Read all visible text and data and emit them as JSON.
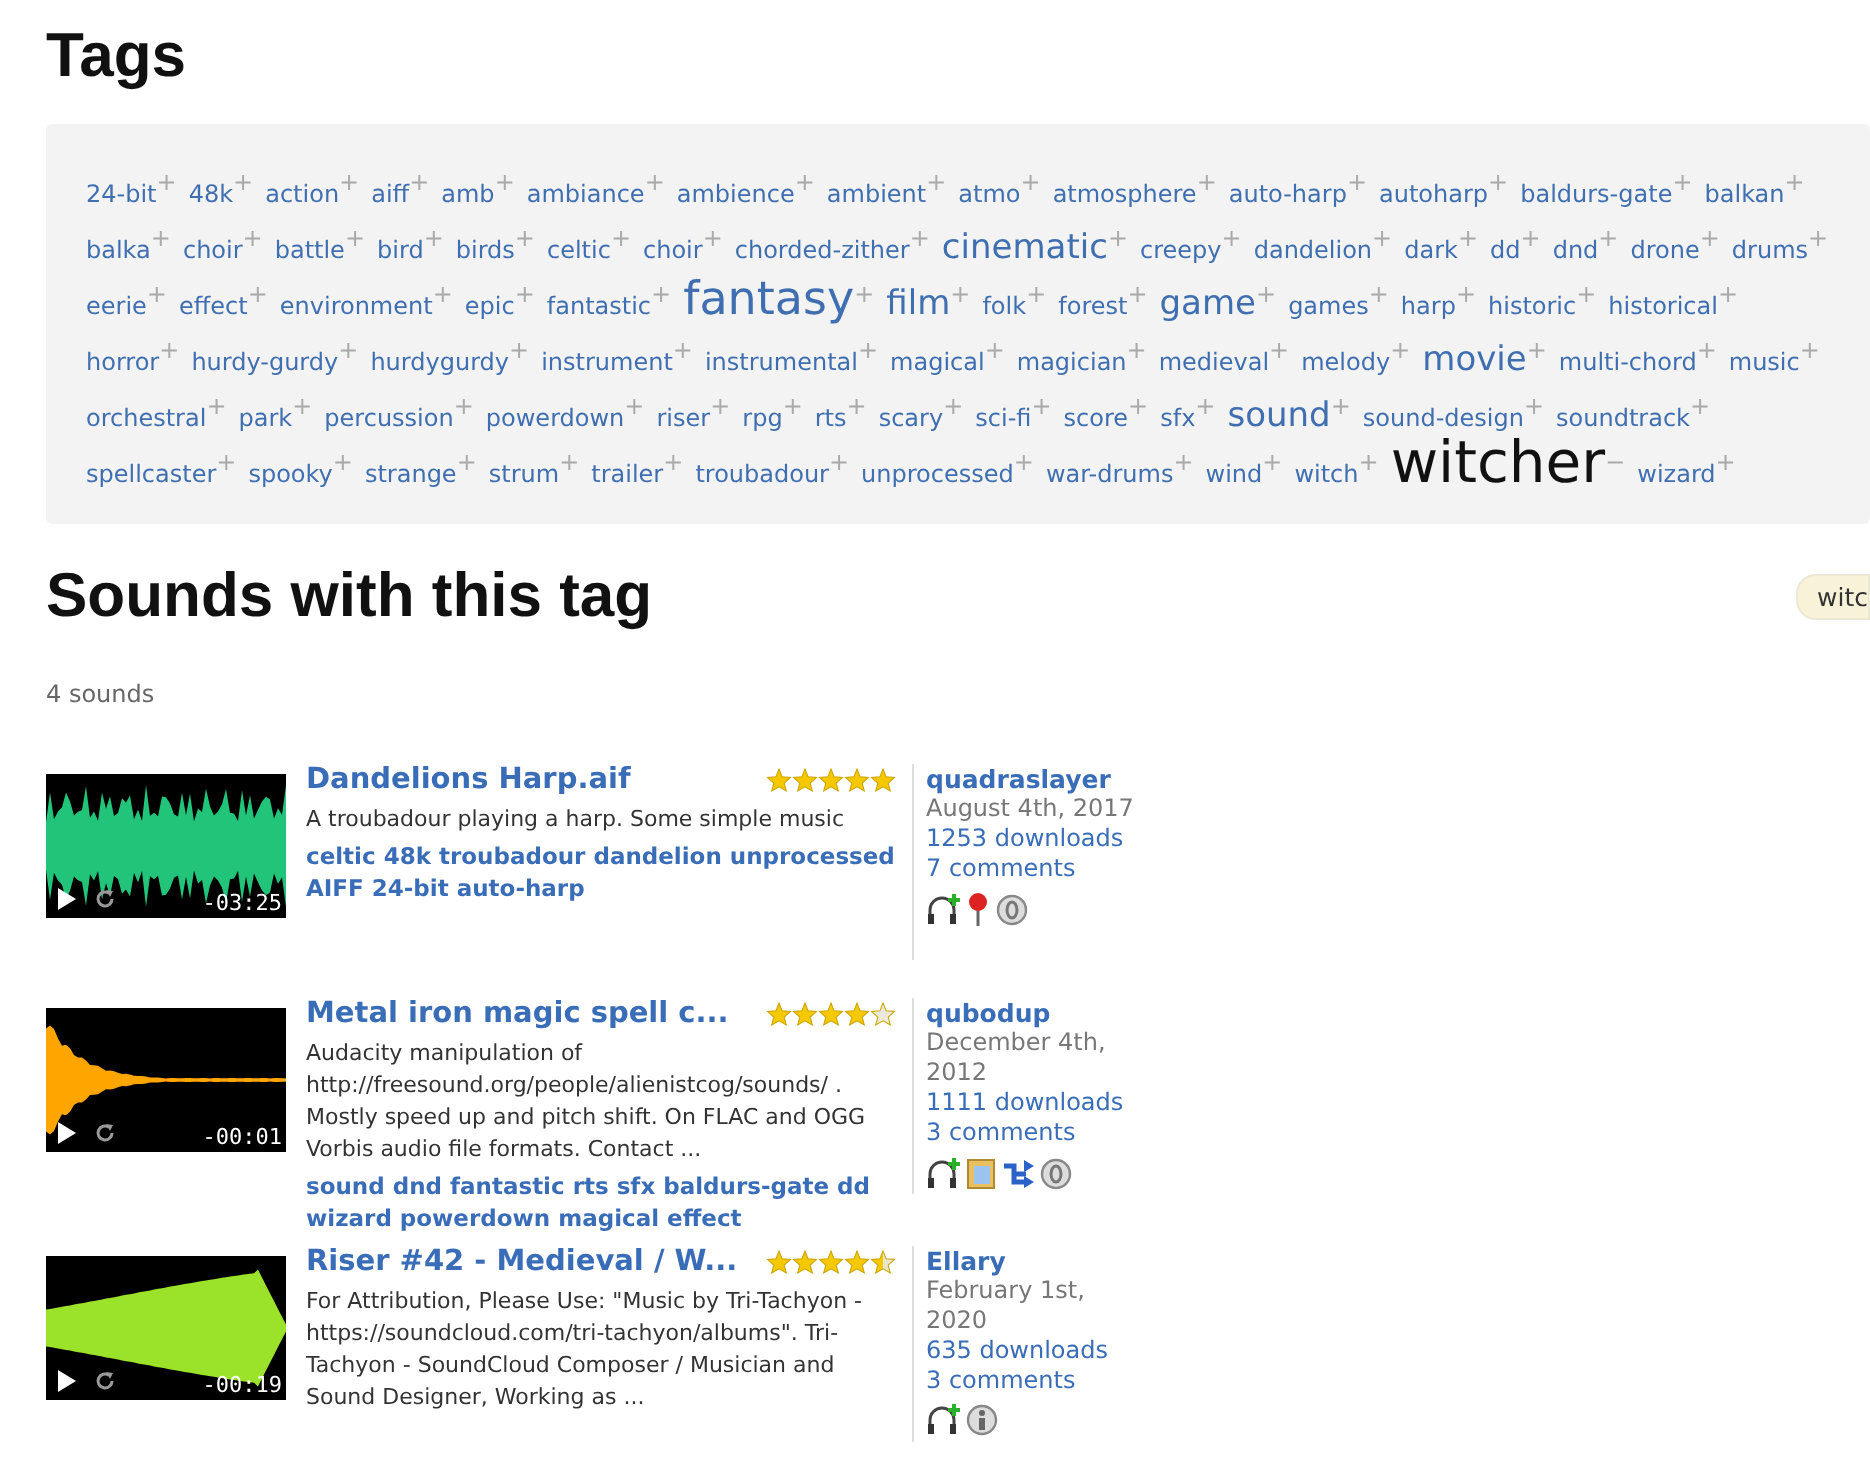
{
  "tags_heading": "Tags",
  "tags": [
    {
      "label": "24-bit",
      "kind": "normal",
      "selected": false,
      "action": "+"
    },
    {
      "label": "48k",
      "kind": "normal",
      "selected": false,
      "action": "+"
    },
    {
      "label": "action",
      "kind": "normal",
      "selected": false,
      "action": "+"
    },
    {
      "label": "aiff",
      "kind": "normal",
      "selected": false,
      "action": "+"
    },
    {
      "label": "amb",
      "kind": "normal",
      "selected": false,
      "action": "+"
    },
    {
      "label": "ambiance",
      "kind": "normal",
      "selected": false,
      "action": "+"
    },
    {
      "label": "ambience",
      "kind": "normal",
      "selected": false,
      "action": "+"
    },
    {
      "label": "ambient",
      "kind": "normal",
      "selected": false,
      "action": "+"
    },
    {
      "label": "atmo",
      "kind": "normal",
      "selected": false,
      "action": "+"
    },
    {
      "label": "atmosphere",
      "kind": "normal",
      "selected": false,
      "action": "+"
    },
    {
      "label": "auto-harp",
      "kind": "normal",
      "selected": false,
      "action": "+"
    },
    {
      "label": "autoharp",
      "kind": "normal",
      "selected": false,
      "action": "+"
    },
    {
      "label": "baldurs-gate",
      "kind": "normal",
      "selected": false,
      "action": "+"
    },
    {
      "label": "balkan",
      "kind": "normal",
      "selected": false,
      "action": "+"
    },
    {
      "label": "balka",
      "kind": "normal",
      "selected": false,
      "action": "+"
    },
    {
      "label": "choir",
      "kind": "normal",
      "selected": false,
      "action": "+"
    },
    {
      "label": "battle",
      "kind": "normal",
      "selected": false,
      "action": "+"
    },
    {
      "label": "bird",
      "kind": "normal",
      "selected": false,
      "action": "+"
    },
    {
      "label": "birds",
      "kind": "normal",
      "selected": false,
      "action": "+"
    },
    {
      "label": "celtic",
      "kind": "normal",
      "selected": false,
      "action": "+"
    },
    {
      "label": "choir",
      "kind": "normal",
      "selected": false,
      "action": "+"
    },
    {
      "label": "chorded-zither",
      "kind": "normal",
      "selected": false,
      "action": "+"
    },
    {
      "label": "cinematic",
      "kind": "large",
      "selected": false,
      "action": "+"
    },
    {
      "label": "creepy",
      "kind": "normal",
      "selected": false,
      "action": "+"
    },
    {
      "label": "dandelion",
      "kind": "normal",
      "selected": false,
      "action": "+"
    },
    {
      "label": "dark",
      "kind": "normal",
      "selected": false,
      "action": "+"
    },
    {
      "label": "dd",
      "kind": "normal",
      "selected": false,
      "action": "+"
    },
    {
      "label": "dnd",
      "kind": "normal",
      "selected": false,
      "action": "+"
    },
    {
      "label": "drone",
      "kind": "normal",
      "selected": false,
      "action": "+"
    },
    {
      "label": "drums",
      "kind": "normal",
      "selected": false,
      "action": "+"
    },
    {
      "label": "eerie",
      "kind": "normal",
      "selected": false,
      "action": "+"
    },
    {
      "label": "effect",
      "kind": "normal",
      "selected": false,
      "action": "+"
    },
    {
      "label": "environment",
      "kind": "normal",
      "selected": false,
      "action": "+"
    },
    {
      "label": "epic",
      "kind": "normal",
      "selected": false,
      "action": "+"
    },
    {
      "label": "fantastic",
      "kind": "normal",
      "selected": false,
      "action": "+"
    },
    {
      "label": "fantasy",
      "kind": "larger",
      "selected": false,
      "action": "+"
    },
    {
      "label": "film",
      "kind": "large",
      "selected": false,
      "action": "+"
    },
    {
      "label": "folk",
      "kind": "normal",
      "selected": false,
      "action": "+"
    },
    {
      "label": "forest",
      "kind": "normal",
      "selected": false,
      "action": "+"
    },
    {
      "label": "game",
      "kind": "large",
      "selected": false,
      "action": "+"
    },
    {
      "label": "games",
      "kind": "normal",
      "selected": false,
      "action": "+"
    },
    {
      "label": "harp",
      "kind": "normal",
      "selected": false,
      "action": "+"
    },
    {
      "label": "historic",
      "kind": "normal",
      "selected": false,
      "action": "+"
    },
    {
      "label": "historical",
      "kind": "normal",
      "selected": false,
      "action": "+"
    },
    {
      "label": "horror",
      "kind": "normal",
      "selected": false,
      "action": "+"
    },
    {
      "label": "hurdy-gurdy",
      "kind": "normal",
      "selected": false,
      "action": "+"
    },
    {
      "label": "hurdygurdy",
      "kind": "normal",
      "selected": false,
      "action": "+"
    },
    {
      "label": "instrument",
      "kind": "normal",
      "selected": false,
      "action": "+"
    },
    {
      "label": "instrumental",
      "kind": "normal",
      "selected": false,
      "action": "+"
    },
    {
      "label": "magical",
      "kind": "normal",
      "selected": false,
      "action": "+"
    },
    {
      "label": "magician",
      "kind": "normal",
      "selected": false,
      "action": "+"
    },
    {
      "label": "medieval",
      "kind": "normal",
      "selected": false,
      "action": "+"
    },
    {
      "label": "melody",
      "kind": "normal",
      "selected": false,
      "action": "+"
    },
    {
      "label": "movie",
      "kind": "large",
      "selected": false,
      "action": "+"
    },
    {
      "label": "multi-chord",
      "kind": "normal",
      "selected": false,
      "action": "+"
    },
    {
      "label": "music",
      "kind": "normal",
      "selected": false,
      "action": "+"
    },
    {
      "label": "orchestral",
      "kind": "normal",
      "selected": false,
      "action": "+"
    },
    {
      "label": "park",
      "kind": "normal",
      "selected": false,
      "action": "+"
    },
    {
      "label": "percussion",
      "kind": "normal",
      "selected": false,
      "action": "+"
    },
    {
      "label": "powerdown",
      "kind": "normal",
      "selected": false,
      "action": "+"
    },
    {
      "label": "riser",
      "kind": "normal",
      "selected": false,
      "action": "+"
    },
    {
      "label": "rpg",
      "kind": "normal",
      "selected": false,
      "action": "+"
    },
    {
      "label": "rts",
      "kind": "normal",
      "selected": false,
      "action": "+"
    },
    {
      "label": "scary",
      "kind": "normal",
      "selected": false,
      "action": "+"
    },
    {
      "label": "sci-fi",
      "kind": "normal",
      "selected": false,
      "action": "+"
    },
    {
      "label": "score",
      "kind": "normal",
      "selected": false,
      "action": "+"
    },
    {
      "label": "sfx",
      "kind": "normal",
      "selected": false,
      "action": "+"
    },
    {
      "label": "sound",
      "kind": "large",
      "selected": false,
      "action": "+"
    },
    {
      "label": "sound-design",
      "kind": "normal",
      "selected": false,
      "action": "+"
    },
    {
      "label": "soundtrack",
      "kind": "normal",
      "selected": false,
      "action": "+"
    },
    {
      "label": "spellcaster",
      "kind": "normal",
      "selected": false,
      "action": "+"
    },
    {
      "label": "spooky",
      "kind": "normal",
      "selected": false,
      "action": "+"
    },
    {
      "label": "strange",
      "kind": "normal",
      "selected": false,
      "action": "+"
    },
    {
      "label": "strum",
      "kind": "normal",
      "selected": false,
      "action": "+"
    },
    {
      "label": "trailer",
      "kind": "normal",
      "selected": false,
      "action": "+"
    },
    {
      "label": "troubadour",
      "kind": "normal",
      "selected": false,
      "action": "+"
    },
    {
      "label": "unprocessed",
      "kind": "normal",
      "selected": false,
      "action": "+"
    },
    {
      "label": "war-drums",
      "kind": "normal",
      "selected": false,
      "action": "+"
    },
    {
      "label": "wind",
      "kind": "normal",
      "selected": false,
      "action": "+"
    },
    {
      "label": "witch",
      "kind": "normal",
      "selected": false,
      "action": "+"
    },
    {
      "label": "witcher",
      "kind": "largest",
      "selected": true,
      "action": "−"
    },
    {
      "label": "wizard",
      "kind": "normal",
      "selected": false,
      "action": "+"
    }
  ],
  "sounds_heading": "Sounds with this tag",
  "filter_chip": "witc",
  "count": "4 sounds",
  "sounds": [
    {
      "title": "Dandelions Harp.aif",
      "stars": 5,
      "color": "#22c47a",
      "time": "-03:25",
      "description": "A troubadour playing a harp. Some simple music",
      "tags": "celtic 48k troubadour dandelion unprocessed AIFF 24-bit auto-harp",
      "user": "quadraslayer",
      "date": "August 4th, 2017",
      "downloads": "1253 downloads",
      "comments": "7 comments",
      "icons": [
        {
          "kind": "headphones"
        },
        {
          "kind": "pin"
        },
        {
          "kind": "license"
        }
      ]
    },
    {
      "title": "Metal iron magic spell c...",
      "stars": 4,
      "color": "#ffa500",
      "time": "-00:01",
      "description": "Audacity manipulation of http://freesound.org/people/alienistcog/sounds/ . Mostly speed up and pitch shift. On FLAC and OGG Vorbis audio file formats. Contact ...",
      "tags": "sound dnd fantastic rts sfx baldurs-gate dd wizard powerdown magical effect",
      "user": "qubodup",
      "date": "December 4th, 2012",
      "downloads": "1111 downloads",
      "comments": "3 comments",
      "icons": [
        {
          "kind": "headphones"
        },
        {
          "kind": "folder"
        },
        {
          "kind": "remix"
        },
        {
          "kind": "license"
        }
      ]
    },
    {
      "title": "Riser #42 - Medieval / W...",
      "stars": 4.5,
      "color": "#9be22a",
      "time": "-00:19",
      "description": "For Attribution, Please Use: \"Music by Tri-Tachyon - https://soundcloud.com/tri-tachyon/albums\". Tri-Tachyon - SoundCloud Composer / Musician and Sound Designer, Working as ...",
      "user": "Ellary",
      "date": "February 1st, 2020",
      "downloads": "635 downloads",
      "comments": "3 comments",
      "icons": [
        {
          "kind": "headphones"
        },
        {
          "kind": "attribution"
        }
      ]
    }
  ]
}
